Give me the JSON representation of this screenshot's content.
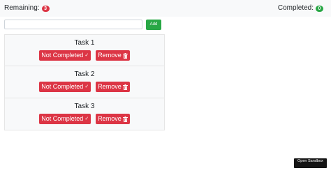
{
  "header": {
    "remaining_label": "Remaining:",
    "remaining_count": "3",
    "completed_label": "Completed:",
    "completed_count": "0"
  },
  "form": {
    "input_value": "",
    "input_placeholder": "",
    "add_label": "Add"
  },
  "tasks": [
    {
      "title": "Task 1",
      "status_label": "Not Completed",
      "remove_label": "Remove"
    },
    {
      "title": "Task 2",
      "status_label": "Not Completed",
      "remove_label": "Remove"
    },
    {
      "title": "Task 3",
      "status_label": "Not Completed",
      "remove_label": "Remove"
    }
  ],
  "icons": {
    "status": "check-icon",
    "remove": "trash-icon"
  },
  "colors": {
    "danger": "#dc3545",
    "success": "#28a745",
    "topbar": "#f8f9fa"
  },
  "sandbox": {
    "label": "Open Sandbox"
  }
}
